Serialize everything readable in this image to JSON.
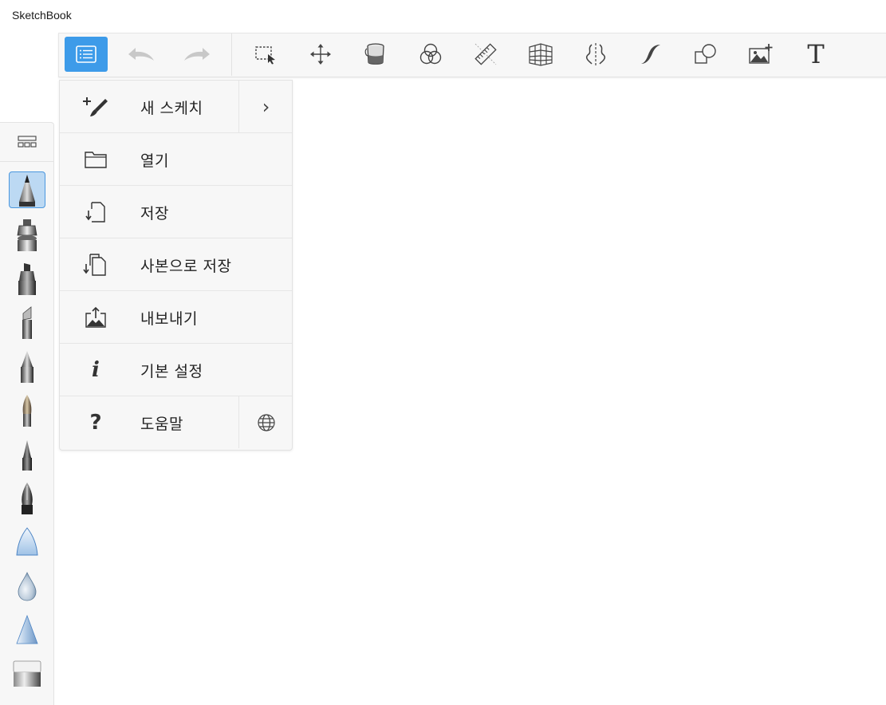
{
  "app": {
    "title": "SketchBook"
  },
  "toolbar": {
    "items": [
      {
        "name": "menu-button",
        "icon": "list-icon",
        "active": true
      },
      {
        "name": "undo-button",
        "icon": "undo-arrow-icon"
      },
      {
        "name": "redo-button",
        "icon": "redo-arrow-icon"
      },
      {
        "name": "select-button",
        "icon": "selection-marquee-icon"
      },
      {
        "name": "transform-button",
        "icon": "move-arrows-icon"
      },
      {
        "name": "fill-button",
        "icon": "paint-bucket-icon"
      },
      {
        "name": "color-editor-button",
        "icon": "color-circles-icon"
      },
      {
        "name": "ruler-button",
        "icon": "ruler-icon"
      },
      {
        "name": "perspective-button",
        "icon": "perspective-grid-icon"
      },
      {
        "name": "symmetry-button",
        "icon": "symmetry-icon"
      },
      {
        "name": "curve-button",
        "icon": "french-curve-icon"
      },
      {
        "name": "shapes-button",
        "icon": "shapes-icon"
      },
      {
        "name": "add-image-button",
        "icon": "add-image-icon"
      },
      {
        "name": "text-button",
        "icon": "text-icon",
        "label": "T"
      }
    ],
    "accent": "#3d9be9"
  },
  "palette": {
    "grid_icon": "brush-library-icon",
    "brushes": [
      {
        "name": "pencil",
        "selected": true
      },
      {
        "name": "airbrush"
      },
      {
        "name": "marker"
      },
      {
        "name": "chisel-marker"
      },
      {
        "name": "ballpoint-pen"
      },
      {
        "name": "paint-brush"
      },
      {
        "name": "ink-pen"
      },
      {
        "name": "fountain-pen"
      },
      {
        "name": "hard-eraser-shape"
      },
      {
        "name": "water-drop"
      },
      {
        "name": "smudge-triangle"
      },
      {
        "name": "eraser"
      }
    ]
  },
  "menu": {
    "items": [
      {
        "label": "새 스케치",
        "icon": "new-sketch-icon",
        "side_icon": "chevron-right-icon",
        "side_glyph": "›"
      },
      {
        "label": "열기",
        "icon": "folder-icon"
      },
      {
        "label": "저장",
        "icon": "save-icon"
      },
      {
        "label": "사본으로 저장",
        "icon": "save-copy-icon"
      },
      {
        "label": "내보내기",
        "icon": "export-icon"
      },
      {
        "label": "기본 설정",
        "icon": "info-icon",
        "glyph": "i"
      },
      {
        "label": "도움말",
        "icon": "help-icon",
        "glyph": "?",
        "side_icon": "globe-icon"
      }
    ]
  }
}
